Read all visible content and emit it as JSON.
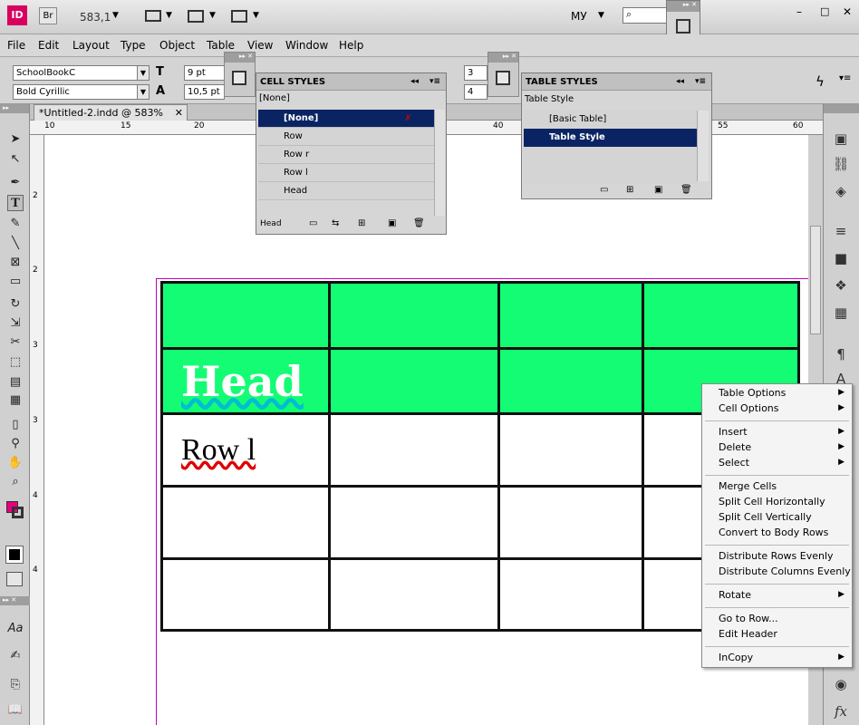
{
  "app": {
    "logo": "ID",
    "bridge": "Br",
    "zoom": "583,1",
    "workspace": "МУ",
    "search_placeholder": ""
  },
  "menu": [
    "File",
    "Edit",
    "Layout",
    "Type",
    "Object",
    "Table",
    "View",
    "Window",
    "Help"
  ],
  "control": {
    "font_family": "SchoolBookC",
    "font_style": "Bold Cyrillic",
    "font_size": "9 pt",
    "leading": "10,5 pt",
    "rows": "3",
    "cols": "4"
  },
  "document": {
    "tab_title": "*Untitled-2.indd @ 583%",
    "ruler_h": [
      "10",
      "15",
      "20",
      "40",
      "55",
      "60"
    ],
    "ruler_v": [
      "2",
      "2",
      "3",
      "3",
      "4",
      "4"
    ],
    "cell_head": "Head",
    "cell_row": "Row l"
  },
  "cell_styles": {
    "title": "CELL STYLES",
    "current": "[None]",
    "items": [
      "[None]",
      "Row",
      "Row r",
      "Row l",
      "Head"
    ],
    "footer_label": "Head"
  },
  "table_styles": {
    "title": "TABLE STYLES",
    "current": "Table Style",
    "items": [
      "[Basic Table]",
      "Table Style"
    ]
  },
  "context_menu": {
    "items": [
      {
        "label": "Table Options",
        "submenu": true
      },
      {
        "label": "Cell Options",
        "submenu": true
      },
      {
        "label": "Insert",
        "submenu": true
      },
      {
        "label": "Delete",
        "submenu": true
      },
      {
        "label": "Select",
        "submenu": true
      },
      {
        "label": "Merge Cells",
        "submenu": false
      },
      {
        "label": "Split Cell Horizontally",
        "submenu": false
      },
      {
        "label": "Split Cell Vertically",
        "submenu": false
      },
      {
        "label": "Convert to Body Rows",
        "submenu": false
      },
      {
        "label": "Distribute Rows Evenly",
        "submenu": false
      },
      {
        "label": "Distribute Columns Evenly",
        "submenu": false
      },
      {
        "label": "Rotate",
        "submenu": true
      },
      {
        "label": "Go to Row...",
        "submenu": false
      },
      {
        "label": "Edit Header",
        "submenu": false
      },
      {
        "label": "InCopy",
        "submenu": true
      }
    ]
  },
  "colors": {
    "header_fill": "#14fc74",
    "selection": "#0a2463",
    "fill_swatch": "#e8007f",
    "page_guide": "#c000c0"
  }
}
